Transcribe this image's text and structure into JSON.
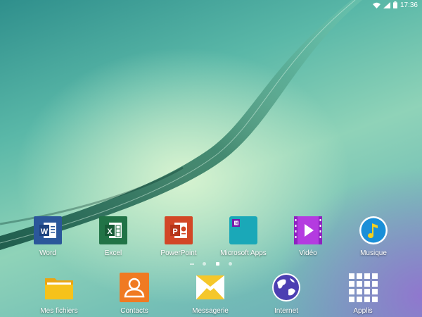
{
  "status": {
    "time": "17:36",
    "icons": [
      "wifi-icon",
      "signal-icon",
      "battery-icon"
    ]
  },
  "apps": [
    {
      "label": "Word",
      "icon": "word-icon",
      "color": "#2b579a"
    },
    {
      "label": "Excel",
      "icon": "excel-icon",
      "color": "#217346"
    },
    {
      "label": "PowerPoint",
      "icon": "powerpoint-icon",
      "color": "#d24726"
    },
    {
      "label": "Microsoft Apps",
      "icon": "microsoft-apps-folder-icon",
      "color": "#1aa8b8"
    },
    {
      "label": "Vidéo",
      "icon": "video-icon",
      "color": "#b43be0"
    },
    {
      "label": "Musique",
      "icon": "music-icon",
      "color": "#1a8fd8"
    }
  ],
  "page_indicator": {
    "pages": 3,
    "current": 2
  },
  "dock": [
    {
      "label": "Mes fichiers",
      "icon": "folder-icon",
      "color": "#f6c21b"
    },
    {
      "label": "Contacts",
      "icon": "contacts-icon",
      "color": "#f07a22"
    },
    {
      "label": "Messagerie",
      "icon": "messaging-icon",
      "color": "#f5c72a"
    },
    {
      "label": "Internet",
      "icon": "internet-globe-icon",
      "color": "#4c3fb2"
    },
    {
      "label": "Applis",
      "icon": "apps-grid-icon",
      "color": "#ffffff"
    }
  ]
}
